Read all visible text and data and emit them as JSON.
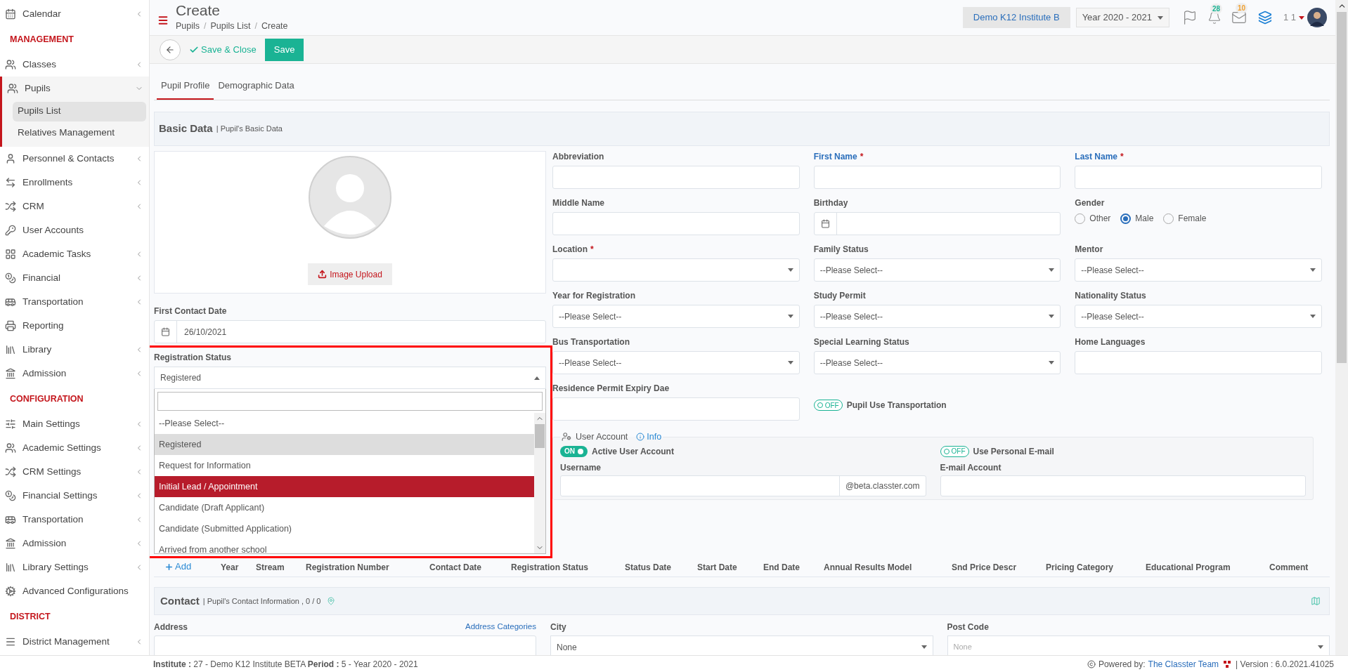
{
  "sidebar": {
    "sections": [
      {
        "items": [
          {
            "label": "Calendar",
            "chevron": true,
            "expanded": false
          }
        ]
      },
      {
        "title": "MANAGEMENT",
        "items": [
          {
            "label": "Classes",
            "chevron": true,
            "expanded": false
          },
          {
            "label": "Pupils",
            "chevron": true,
            "expanded": true,
            "children": [
              {
                "label": "Pupils List",
                "selected": true
              },
              {
                "label": "Relatives Management",
                "selected": false
              }
            ]
          },
          {
            "label": "Personnel & Contacts",
            "chevron": true,
            "expanded": false
          },
          {
            "label": "Enrollments",
            "chevron": true,
            "expanded": false
          },
          {
            "label": "CRM",
            "chevron": true,
            "expanded": false
          },
          {
            "label": "User Accounts",
            "chevron": false,
            "expanded": false
          },
          {
            "label": "Academic Tasks",
            "chevron": true,
            "expanded": false
          },
          {
            "label": "Financial",
            "chevron": true,
            "expanded": false
          },
          {
            "label": "Transportation",
            "chevron": true,
            "expanded": false
          },
          {
            "label": "Reporting",
            "chevron": false,
            "expanded": false
          },
          {
            "label": "Library",
            "chevron": true,
            "expanded": false
          },
          {
            "label": "Admission",
            "chevron": true,
            "expanded": false
          }
        ]
      },
      {
        "title": "CONFIGURATION",
        "items": [
          {
            "label": "Main Settings",
            "chevron": true,
            "expanded": false
          },
          {
            "label": "Academic Settings",
            "chevron": true,
            "expanded": false
          },
          {
            "label": "CRM Settings",
            "chevron": true,
            "expanded": false
          },
          {
            "label": "Financial Settings",
            "chevron": true,
            "expanded": false
          },
          {
            "label": "Transportation",
            "chevron": true,
            "expanded": false
          },
          {
            "label": "Admission",
            "chevron": true,
            "expanded": false
          },
          {
            "label": "Library Settings",
            "chevron": true,
            "expanded": false
          },
          {
            "label": "Advanced Configurations",
            "chevron": false,
            "expanded": false
          }
        ]
      },
      {
        "title": "DISTRICT",
        "items": [
          {
            "label": "District Management",
            "chevron": true,
            "expanded": false
          }
        ]
      }
    ]
  },
  "required_mark": "*",
  "header": {
    "title": "Create",
    "breadcrumbs": [
      "Pupils",
      "Pupils List",
      "Create"
    ],
    "breadcrumb_separator": "/",
    "institute": "Demo K12 Institute B",
    "year": "Year 2020 - 2021",
    "notifications": "28",
    "messages": "10",
    "user": "1 1"
  },
  "toolbar": {
    "save_close": "Save & Close",
    "save": "Save"
  },
  "tabs": [
    {
      "label": "Pupil Profile",
      "selected": true
    },
    {
      "label": "Demographic Data",
      "selected": false
    }
  ],
  "basic_data": {
    "title": "Basic Data",
    "subtitle": "| Pupil's Basic Data"
  },
  "photo": {
    "upload": "Image Upload"
  },
  "first_contact": {
    "label": "First Contact Date",
    "value": "26/10/2021"
  },
  "registration_status": {
    "label": "Registration Status",
    "value": "Registered",
    "open": true,
    "options": [
      {
        "label": "--Please Select--",
        "selected": false,
        "hovered": false
      },
      {
        "label": "Registered",
        "selected": true,
        "hovered": false
      },
      {
        "label": "Request for Information",
        "selected": false,
        "hovered": false
      },
      {
        "label": "Initial Lead / Appointment",
        "selected": false,
        "hovered": true
      },
      {
        "label": "Candidate (Draft Applicant)",
        "selected": false,
        "hovered": false
      },
      {
        "label": "Candidate (Submitted Application)",
        "selected": false,
        "hovered": false
      },
      {
        "label": "Arrived from another school",
        "selected": false,
        "hovered": false
      }
    ]
  },
  "fields": [
    {
      "kind": "text",
      "label": "Abbreviation",
      "required": false,
      "highlighted": false
    },
    {
      "kind": "text",
      "label": "First Name",
      "required": true,
      "highlighted": true
    },
    {
      "kind": "text",
      "label": "Last Name",
      "required": true,
      "highlighted": true
    },
    {
      "kind": "text",
      "label": "Middle Name",
      "required": false,
      "highlighted": false
    },
    {
      "kind": "date",
      "label": "Birthday",
      "required": false,
      "highlighted": false
    },
    {
      "kind": "radio",
      "label": "Gender",
      "required": false,
      "highlighted": false,
      "options": [
        {
          "label": "Other",
          "selected": false
        },
        {
          "label": "Male",
          "selected": true
        },
        {
          "label": "Female",
          "selected": false
        }
      ]
    },
    {
      "kind": "select",
      "label": "Location",
      "required": true,
      "highlighted": false
    },
    {
      "kind": "select",
      "label": "Family Status",
      "required": false,
      "highlighted": false,
      "placeholder": "--Please Select--"
    },
    {
      "kind": "select",
      "label": "Mentor",
      "required": false,
      "highlighted": false,
      "placeholder": "--Please Select--"
    },
    {
      "kind": "select",
      "label": "Year for Registration",
      "required": false,
      "highlighted": false,
      "placeholder": "--Please Select--"
    },
    {
      "kind": "select",
      "label": "Study Permit",
      "required": false,
      "highlighted": false,
      "placeholder": "--Please Select--"
    },
    {
      "kind": "select",
      "label": "Nationality Status",
      "required": false,
      "highlighted": false,
      "placeholder": "--Please Select--"
    },
    {
      "kind": "select",
      "label": "Bus Transportation",
      "required": false,
      "highlighted": false,
      "placeholder": "--Please Select--"
    },
    {
      "kind": "select",
      "label": "Special Learning Status",
      "required": false,
      "highlighted": false,
      "placeholder": "--Please Select--"
    },
    {
      "kind": "text",
      "label": "Home Languages",
      "required": false,
      "highlighted": false
    },
    {
      "kind": "text",
      "label": "Residence Permit Expiry Dae",
      "required": false,
      "highlighted": false
    },
    {
      "kind": "toggle",
      "label": "Pupil Use Transportation",
      "on": false,
      "switch_text": "OFF"
    }
  ],
  "user_account": {
    "title": "User Account",
    "info": "Info",
    "toggles": [
      {
        "label": "Active User Account",
        "on": true,
        "switch_text": "ON"
      },
      {
        "label": "Use Personal E-mail",
        "on": false,
        "switch_text": "OFF"
      }
    ],
    "username": {
      "label": "Username",
      "suffix": "@beta.classter.com"
    },
    "email": {
      "label": "E-mail Account"
    }
  },
  "registrations": {
    "add": "Add",
    "columns": [
      "Year",
      "Stream",
      "Registration Number",
      "Contact Date",
      "Registration Status",
      "Status Date",
      "Start Date",
      "End Date",
      "Annual Results Model",
      "Snd Price Descr",
      "Pricing Category",
      "Educational Program",
      "Comment"
    ]
  },
  "contact": {
    "title": "Contact",
    "subtitle": "| Pupil's Contact Information , 0 / 0",
    "address": {
      "label": "Address",
      "link": "Address Categories"
    },
    "city": {
      "label": "City",
      "value": "None"
    },
    "post_code": {
      "label": "Post Code",
      "placeholder": "None"
    }
  },
  "footer": {
    "info": "**Institute :** 27 - Demo K12 Institute BETA **Period :** 5 - Year 2020 - 2021",
    "powered": "Powered by:",
    "team": "The Classter Team",
    "version": "| Version : 6.0.2021.41025"
  }
}
